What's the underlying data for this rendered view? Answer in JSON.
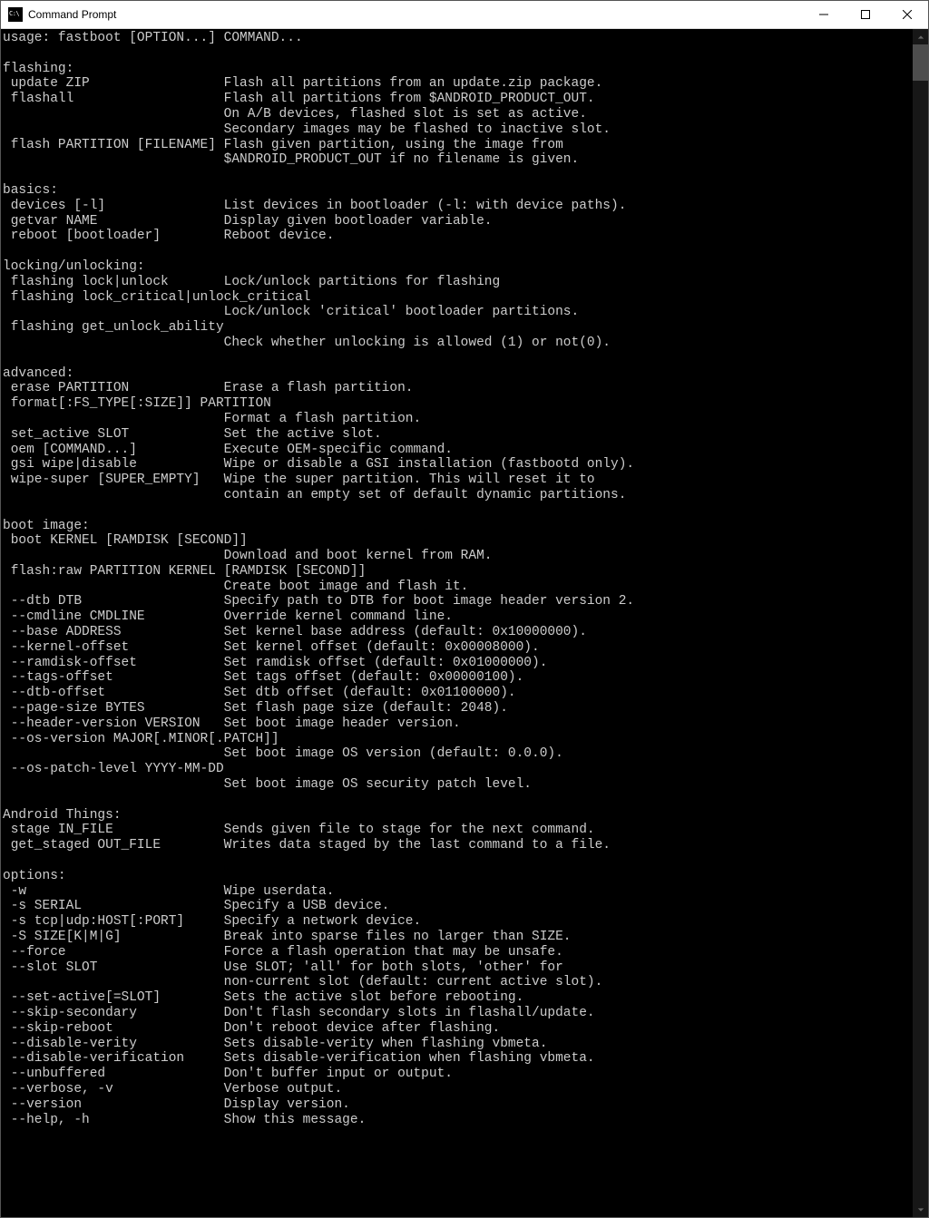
{
  "window": {
    "title": "Command Prompt"
  },
  "terminal": {
    "content": "usage: fastboot [OPTION...] COMMAND...\n\nflashing:\n update ZIP                 Flash all partitions from an update.zip package.\n flashall                   Flash all partitions from $ANDROID_PRODUCT_OUT.\n                            On A/B devices, flashed slot is set as active.\n                            Secondary images may be flashed to inactive slot.\n flash PARTITION [FILENAME] Flash given partition, using the image from\n                            $ANDROID_PRODUCT_OUT if no filename is given.\n\nbasics:\n devices [-l]               List devices in bootloader (-l: with device paths).\n getvar NAME                Display given bootloader variable.\n reboot [bootloader]        Reboot device.\n\nlocking/unlocking:\n flashing lock|unlock       Lock/unlock partitions for flashing\n flashing lock_critical|unlock_critical\n                            Lock/unlock 'critical' bootloader partitions.\n flashing get_unlock_ability\n                            Check whether unlocking is allowed (1) or not(0).\n\nadvanced:\n erase PARTITION            Erase a flash partition.\n format[:FS_TYPE[:SIZE]] PARTITION\n                            Format a flash partition.\n set_active SLOT            Set the active slot.\n oem [COMMAND...]           Execute OEM-specific command.\n gsi wipe|disable           Wipe or disable a GSI installation (fastbootd only).\n wipe-super [SUPER_EMPTY]   Wipe the super partition. This will reset it to\n                            contain an empty set of default dynamic partitions.\n\nboot image:\n boot KERNEL [RAMDISK [SECOND]]\n                            Download and boot kernel from RAM.\n flash:raw PARTITION KERNEL [RAMDISK [SECOND]]\n                            Create boot image and flash it.\n --dtb DTB                  Specify path to DTB for boot image header version 2.\n --cmdline CMDLINE          Override kernel command line.\n --base ADDRESS             Set kernel base address (default: 0x10000000).\n --kernel-offset            Set kernel offset (default: 0x00008000).\n --ramdisk-offset           Set ramdisk offset (default: 0x01000000).\n --tags-offset              Set tags offset (default: 0x00000100).\n --dtb-offset               Set dtb offset (default: 0x01100000).\n --page-size BYTES          Set flash page size (default: 2048).\n --header-version VERSION   Set boot image header version.\n --os-version MAJOR[.MINOR[.PATCH]]\n                            Set boot image OS version (default: 0.0.0).\n --os-patch-level YYYY-MM-DD\n                            Set boot image OS security patch level.\n\nAndroid Things:\n stage IN_FILE              Sends given file to stage for the next command.\n get_staged OUT_FILE        Writes data staged by the last command to a file.\n\noptions:\n -w                         Wipe userdata.\n -s SERIAL                  Specify a USB device.\n -s tcp|udp:HOST[:PORT]     Specify a network device.\n -S SIZE[K|M|G]             Break into sparse files no larger than SIZE.\n --force                    Force a flash operation that may be unsafe.\n --slot SLOT                Use SLOT; 'all' for both slots, 'other' for\n                            non-current slot (default: current active slot).\n --set-active[=SLOT]        Sets the active slot before rebooting.\n --skip-secondary           Don't flash secondary slots in flashall/update.\n --skip-reboot              Don't reboot device after flashing.\n --disable-verity           Sets disable-verity when flashing vbmeta.\n --disable-verification     Sets disable-verification when flashing vbmeta.\n --unbuffered               Don't buffer input or output.\n --verbose, -v              Verbose output.\n --version                  Display version.\n --help, -h                 Show this message."
  }
}
